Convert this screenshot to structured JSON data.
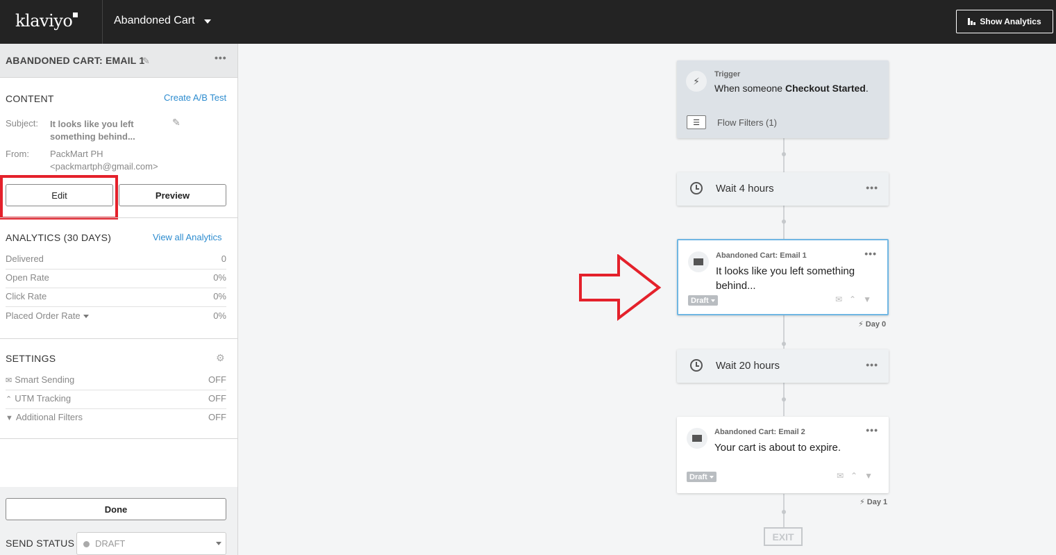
{
  "topbar": {
    "logo": "klaviyo",
    "flow_name": "Abandoned Cart",
    "show_analytics_label": "Show Analytics"
  },
  "panel": {
    "title": "ABANDONED CART: EMAIL 1",
    "content_label": "CONTENT",
    "ab_test_link": "Create A/B Test",
    "subject_key": "Subject:",
    "subject_value": "It looks like you left something behind...",
    "from_key": "From:",
    "from_name": "PackMart PH",
    "from_email": "<packmartph@gmail.com>",
    "edit_label": "Edit",
    "preview_label": "Preview",
    "analytics_label": "ANALYTICS (30 DAYS)",
    "view_analytics_link": "View all Analytics",
    "analytics_rows": [
      {
        "key": "Delivered",
        "value": "0"
      },
      {
        "key": "Open Rate",
        "value": "0%"
      },
      {
        "key": "Click Rate",
        "value": "0%"
      },
      {
        "key": "Placed Order Rate",
        "value": "0%"
      }
    ],
    "settings_label": "SETTINGS",
    "settings_rows": [
      {
        "key": "Smart Sending",
        "value": "OFF",
        "icon": "smart-sending-icon"
      },
      {
        "key": "UTM Tracking",
        "value": "OFF",
        "icon": "utm-tracking-icon"
      },
      {
        "key": "Additional Filters",
        "value": "OFF",
        "icon": "filter-icon"
      }
    ],
    "done_label": "Done",
    "send_status_label": "SEND STATUS",
    "send_status_value": "DRAFT"
  },
  "flow": {
    "trigger": {
      "label": "Trigger",
      "text_prefix": "When someone",
      "event": "Checkout Started",
      "text_suffix": ".",
      "filters": "Flow Filters (1)"
    },
    "wait1": "Wait 4 hours",
    "email1": {
      "label": "Abandoned Cart: Email 1",
      "subject": "It looks like you left something behind...",
      "status": "Draft",
      "day": "Day 0"
    },
    "wait2": "Wait 20 hours",
    "email2": {
      "label": "Abandoned Cart: Email 2",
      "subject": "Your cart is about to expire.",
      "status": "Draft",
      "day": "Day 1"
    },
    "exit": "EXIT"
  },
  "colors": {
    "topbar": "#232323",
    "link": "#2d8ccf",
    "highlight": "#e4212b",
    "active_card_border": "#6fb6e3"
  }
}
